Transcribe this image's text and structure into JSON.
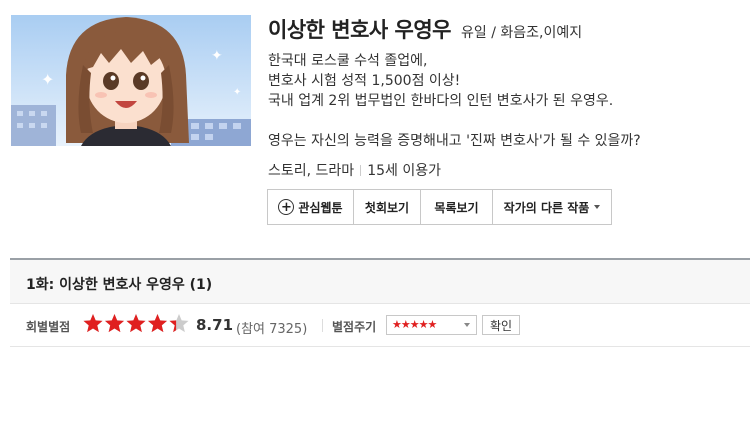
{
  "webtoon": {
    "title": "이상한 변호사 우영우",
    "authors": "유일 / 화음조,이예지",
    "description": [
      "한국대 로스쿨 수석 졸업에,",
      "변호사 시험 성적 1,500점 이상!",
      "국내 업계 2위 법무법인 한바다의 인턴 변호사가 된 우영우.",
      "영우는 자신의 능력을 증명해내고 '진짜 변호사'가 될 수 있을까?"
    ],
    "genre": "스토리, 드라마",
    "age": "15세 이용가"
  },
  "buttons": {
    "favorite": "관심웹툰",
    "first_episode": "첫회보기",
    "list": "목록보기",
    "other_works": "작가의 다른 작품"
  },
  "episode": {
    "title": "1화: 이상한 변호사 우영우 (1)",
    "rating_label": "회별별점",
    "score": "8.71",
    "rating_fraction": 0.871,
    "participants": "(참여 7325)",
    "my_rating_label": "별점주기",
    "my_rating_value": "★★★★★",
    "confirm": "확인"
  },
  "colors": {
    "star": "#e02020",
    "star_empty": "#cccccc"
  }
}
